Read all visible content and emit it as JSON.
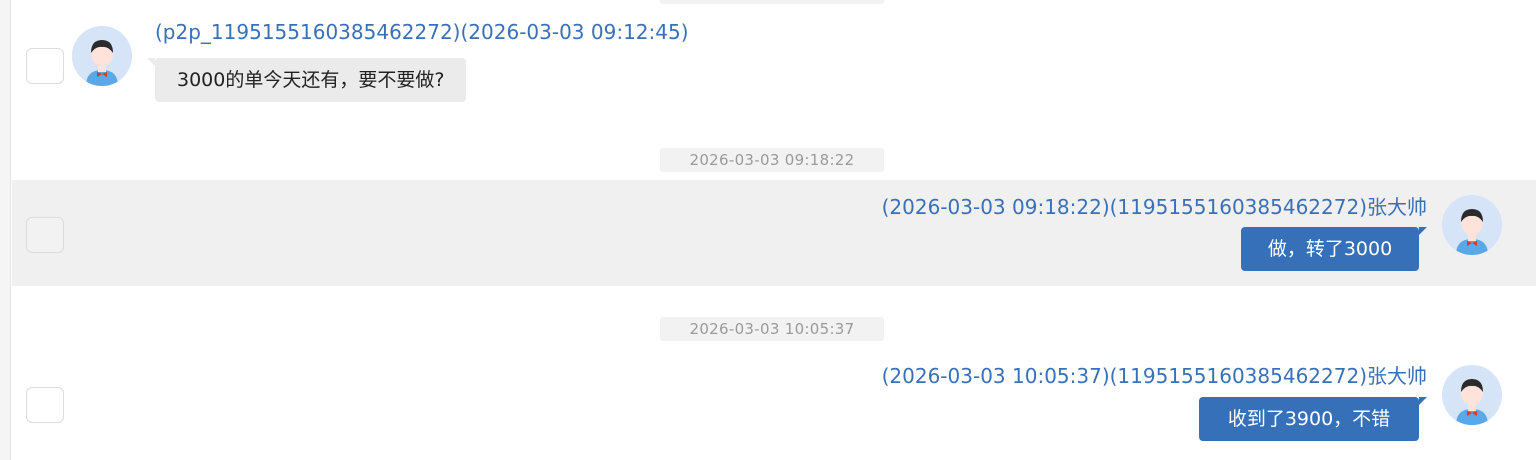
{
  "messages": [
    {
      "timestamp": "",
      "sender_meta": "(p2p_1195155160385462272)(2026-03-03 09:12:45)",
      "text": "3000的单今天还有，要不要做?",
      "direction": "incoming"
    },
    {
      "timestamp": "2026-03-03 09:18:22",
      "sender_meta": "(2026-03-03 09:18:22)(1195155160385462272)张大帅",
      "text": "做，转了3000",
      "direction": "outgoing",
      "highlighted": true
    },
    {
      "timestamp": "2026-03-03 10:05:37",
      "sender_meta": "(2026-03-03 10:05:37)(1195155160385462272)张大帅",
      "text": "收到了3900，不错",
      "direction": "outgoing"
    }
  ],
  "colors": {
    "link_blue": "#3a70b8",
    "outgoing_bubble": "#3670b9",
    "incoming_bubble": "#ebebeb",
    "highlight_row": "#f0f0f0",
    "avatar_bg": "#d6e4f8"
  },
  "icons": {
    "avatar": "user-avatar-icon",
    "checkbox": "checkbox-icon"
  }
}
